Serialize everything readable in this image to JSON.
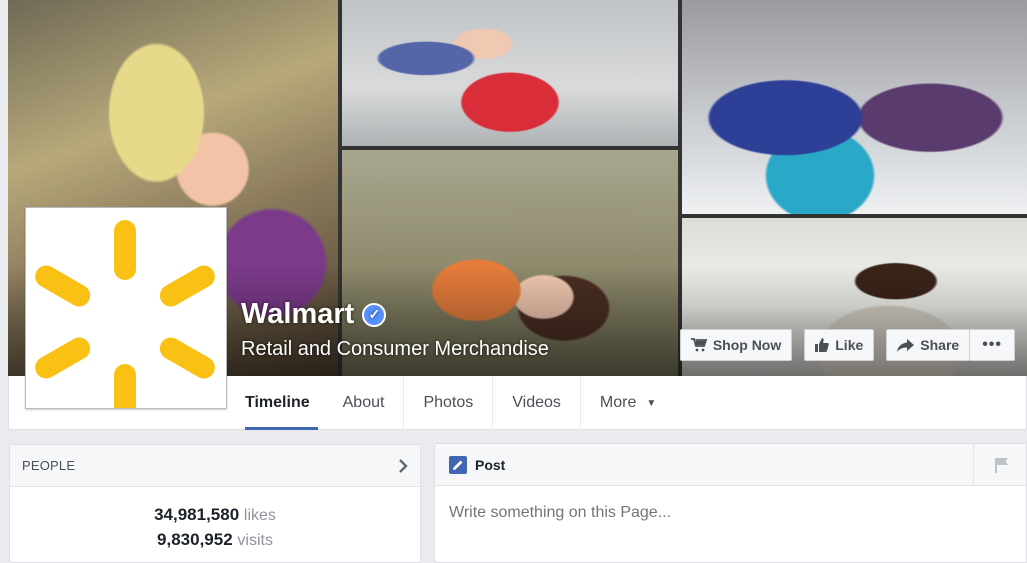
{
  "page": {
    "name": "Walmart",
    "category": "Retail and Consumer Merchandise"
  },
  "cover_actions": {
    "shop_now": "Shop Now",
    "like": "Like",
    "share": "Share",
    "more": "•••"
  },
  "tabs": [
    "Timeline",
    "About",
    "Photos",
    "Videos",
    "More"
  ],
  "people": {
    "title": "PEOPLE",
    "likes_count": "34,981,580",
    "likes_label": "likes",
    "visits_count": "9,830,952",
    "visits_label": "visits"
  },
  "composer": {
    "title": "Post",
    "placeholder": "Write something on this Page..."
  },
  "colors": {
    "brand_yellow": "#f9c114",
    "facebook_blue": "#4267b2",
    "verified_blue": "#5890ff"
  },
  "icons": {
    "verified": "verified-badge-icon",
    "cart": "cart-icon",
    "like": "thumbs-up-icon",
    "share": "share-arrow-icon",
    "chevron": "chevron-right-icon",
    "pencil": "pencil-icon",
    "flag": "flag-icon"
  }
}
